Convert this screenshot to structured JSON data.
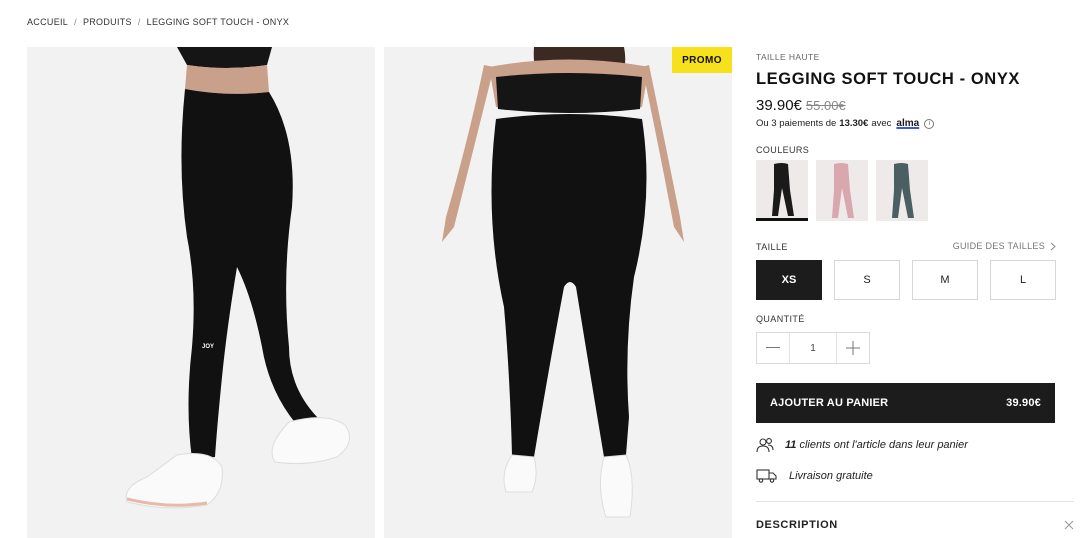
{
  "breadcrumb": {
    "items": [
      "ACCUEIL",
      "PRODUITS",
      "LEGGING SOFT TOUCH - ONYX"
    ],
    "separator": "/"
  },
  "gallery": {
    "promo_label": "PROMO",
    "logo_text_front": "JOY"
  },
  "product": {
    "subtitle": "TAILLE HAUTE",
    "title": "LEGGING SOFT TOUCH - ONYX",
    "price": "39.90€",
    "old_price": "55.00€",
    "alma_prefix": "Ou 3 paiements de",
    "alma_amount": "13.30€",
    "alma_mid": "avec",
    "alma_brand": "alma",
    "colors_label": "COULEURS",
    "colors": [
      {
        "name": "onyx",
        "hex": "#1a1a1a"
      },
      {
        "name": "pink",
        "hex": "#d9a7ae"
      },
      {
        "name": "teal",
        "hex": "#4b5f63"
      }
    ],
    "size_label": "TAILLE",
    "size_guide": "GUIDE DES TAILLES",
    "sizes": [
      "XS",
      "S",
      "M",
      "L"
    ],
    "selected_size": "XS",
    "quantity_label": "QUANTITÉ",
    "quantity": "1",
    "add_to_cart": "AJOUTER AU PANIER",
    "cart_price": "39.90€",
    "cart_count": "11",
    "cart_count_text": "clients ont l'article dans leur panier",
    "shipping_text": "Livraison gratuite",
    "description_label": "DESCRIPTION"
  },
  "colors": {
    "accent": "#1c1c1c",
    "promo": "#f7e11c",
    "alma": "#3b5bdb"
  }
}
